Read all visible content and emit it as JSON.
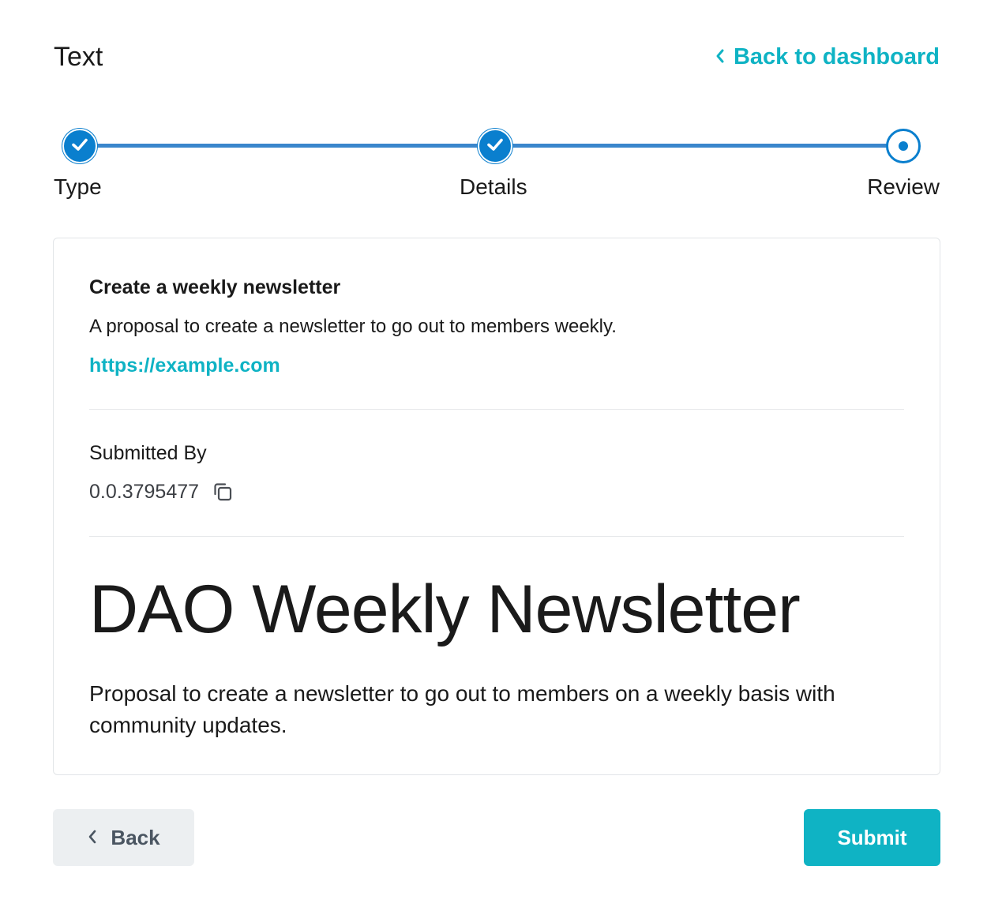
{
  "header": {
    "title": "Text",
    "back_link_label": "Back to dashboard"
  },
  "stepper": {
    "steps": [
      {
        "label": "Type",
        "state": "complete"
      },
      {
        "label": "Details",
        "state": "complete"
      },
      {
        "label": "Review",
        "state": "current"
      }
    ]
  },
  "review": {
    "proposal_title": "Create a weekly newsletter",
    "proposal_description": "A proposal to create a newsletter to go out to members weekly.",
    "proposal_link": "https://example.com",
    "submitted_by_label": "Submitted By",
    "submitted_by_account": "0.0.3795477",
    "content_heading": "DAO Weekly Newsletter",
    "content_body": "Proposal to create a newsletter to go out to members on a weekly basis with community updates."
  },
  "footer": {
    "back_label": "Back",
    "submit_label": "Submit"
  },
  "colors": {
    "accent": "#0fb3c4",
    "step_blue": "#0a7fce",
    "step_line": "#3a86cc"
  },
  "icons": {
    "back_link": "chevron-left-icon",
    "complete_step": "check-icon",
    "copy": "copy-icon",
    "back_button": "chevron-left-icon"
  }
}
